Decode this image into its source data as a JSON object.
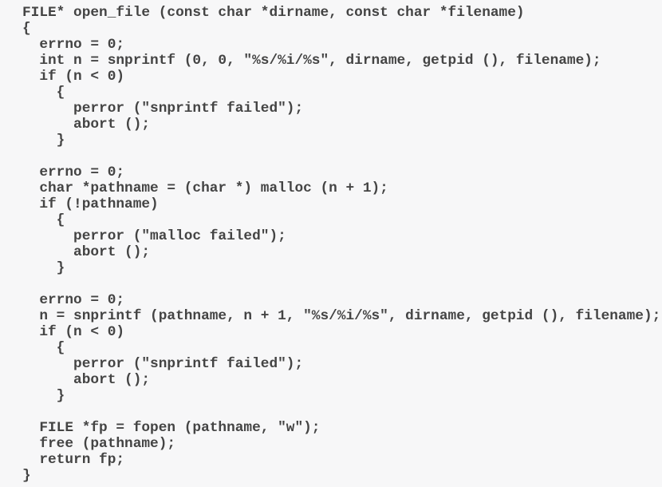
{
  "document": {
    "kind": "source-code-listing",
    "language": "C",
    "function_name": "open_file",
    "background_color": "#f7f7f8",
    "text_color": "#444444",
    "font_weight": "bold",
    "font_size_px": 17.8,
    "line_height_px": 20,
    "brace_style": "GNU"
  },
  "code": {
    "lines": [
      "FILE* open_file (const char *dirname, const char *filename)",
      "{",
      "  errno = 0;",
      "  int n = snprintf (0, 0, \"%s/%i/%s\", dirname, getpid (), filename);",
      "  if (n < 0)",
      "    {",
      "      perror (\"snprintf failed\");",
      "      abort ();",
      "    }",
      "",
      "  errno = 0;",
      "  char *pathname = (char *) malloc (n + 1);",
      "  if (!pathname)",
      "    {",
      "      perror (\"malloc failed\");",
      "      abort ();",
      "    }",
      "",
      "  errno = 0;",
      "  n = snprintf (pathname, n + 1, \"%s/%i/%s\", dirname, getpid (), filename);",
      "  if (n < 0)",
      "    {",
      "      perror (\"snprintf failed\");",
      "      abort ();",
      "    }",
      "",
      "  FILE *fp = fopen (pathname, \"w\");",
      "  free (pathname);",
      "  return fp;",
      "}"
    ]
  }
}
